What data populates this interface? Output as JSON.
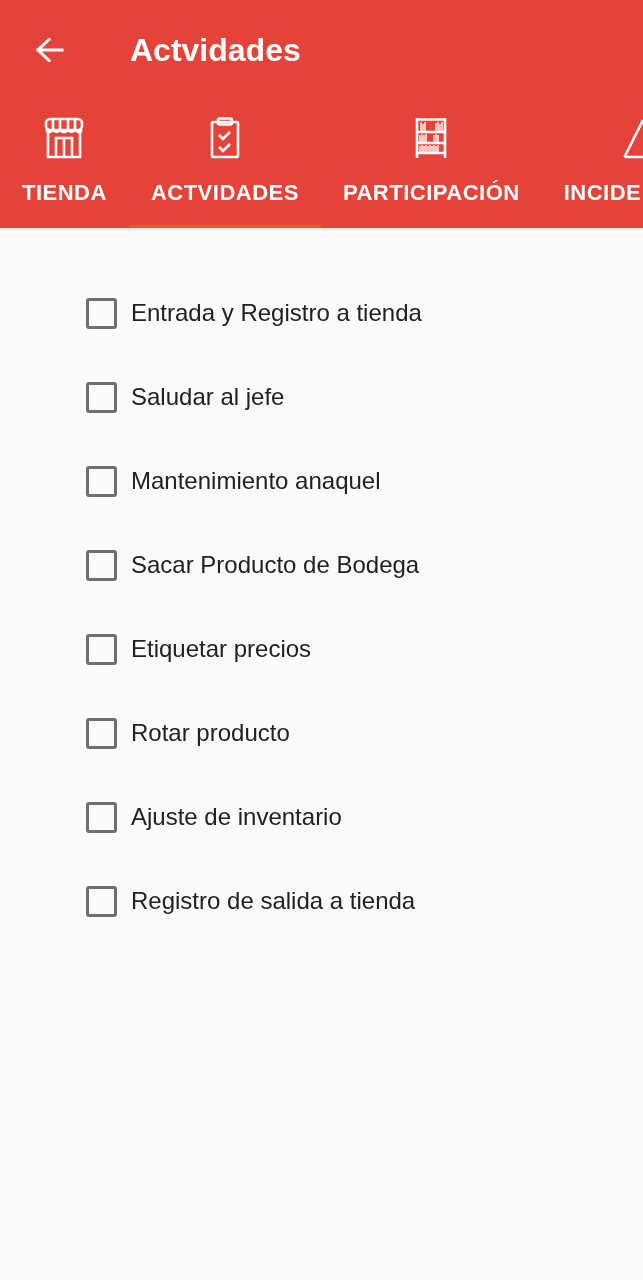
{
  "app_bar": {
    "title": "Actvidades"
  },
  "tabs": [
    {
      "label": "TIENDA",
      "selected": false
    },
    {
      "label": "ACTVIDADES",
      "selected": true
    },
    {
      "label": "PARTICIPACIÓN",
      "selected": false
    },
    {
      "label": "INCIDE",
      "selected": false
    }
  ],
  "activities": [
    {
      "label": "Entrada y Registro a tienda",
      "checked": false
    },
    {
      "label": "Saludar al jefe",
      "checked": false
    },
    {
      "label": "Mantenimiento anaquel",
      "checked": false
    },
    {
      "label": "Sacar Producto de Bodega",
      "checked": false
    },
    {
      "label": "Etiquetar precios",
      "checked": false
    },
    {
      "label": "Rotar producto",
      "checked": false
    },
    {
      "label": "Ajuste de inventario",
      "checked": false
    },
    {
      "label": "Registro de salida a tienda",
      "checked": false
    }
  ]
}
